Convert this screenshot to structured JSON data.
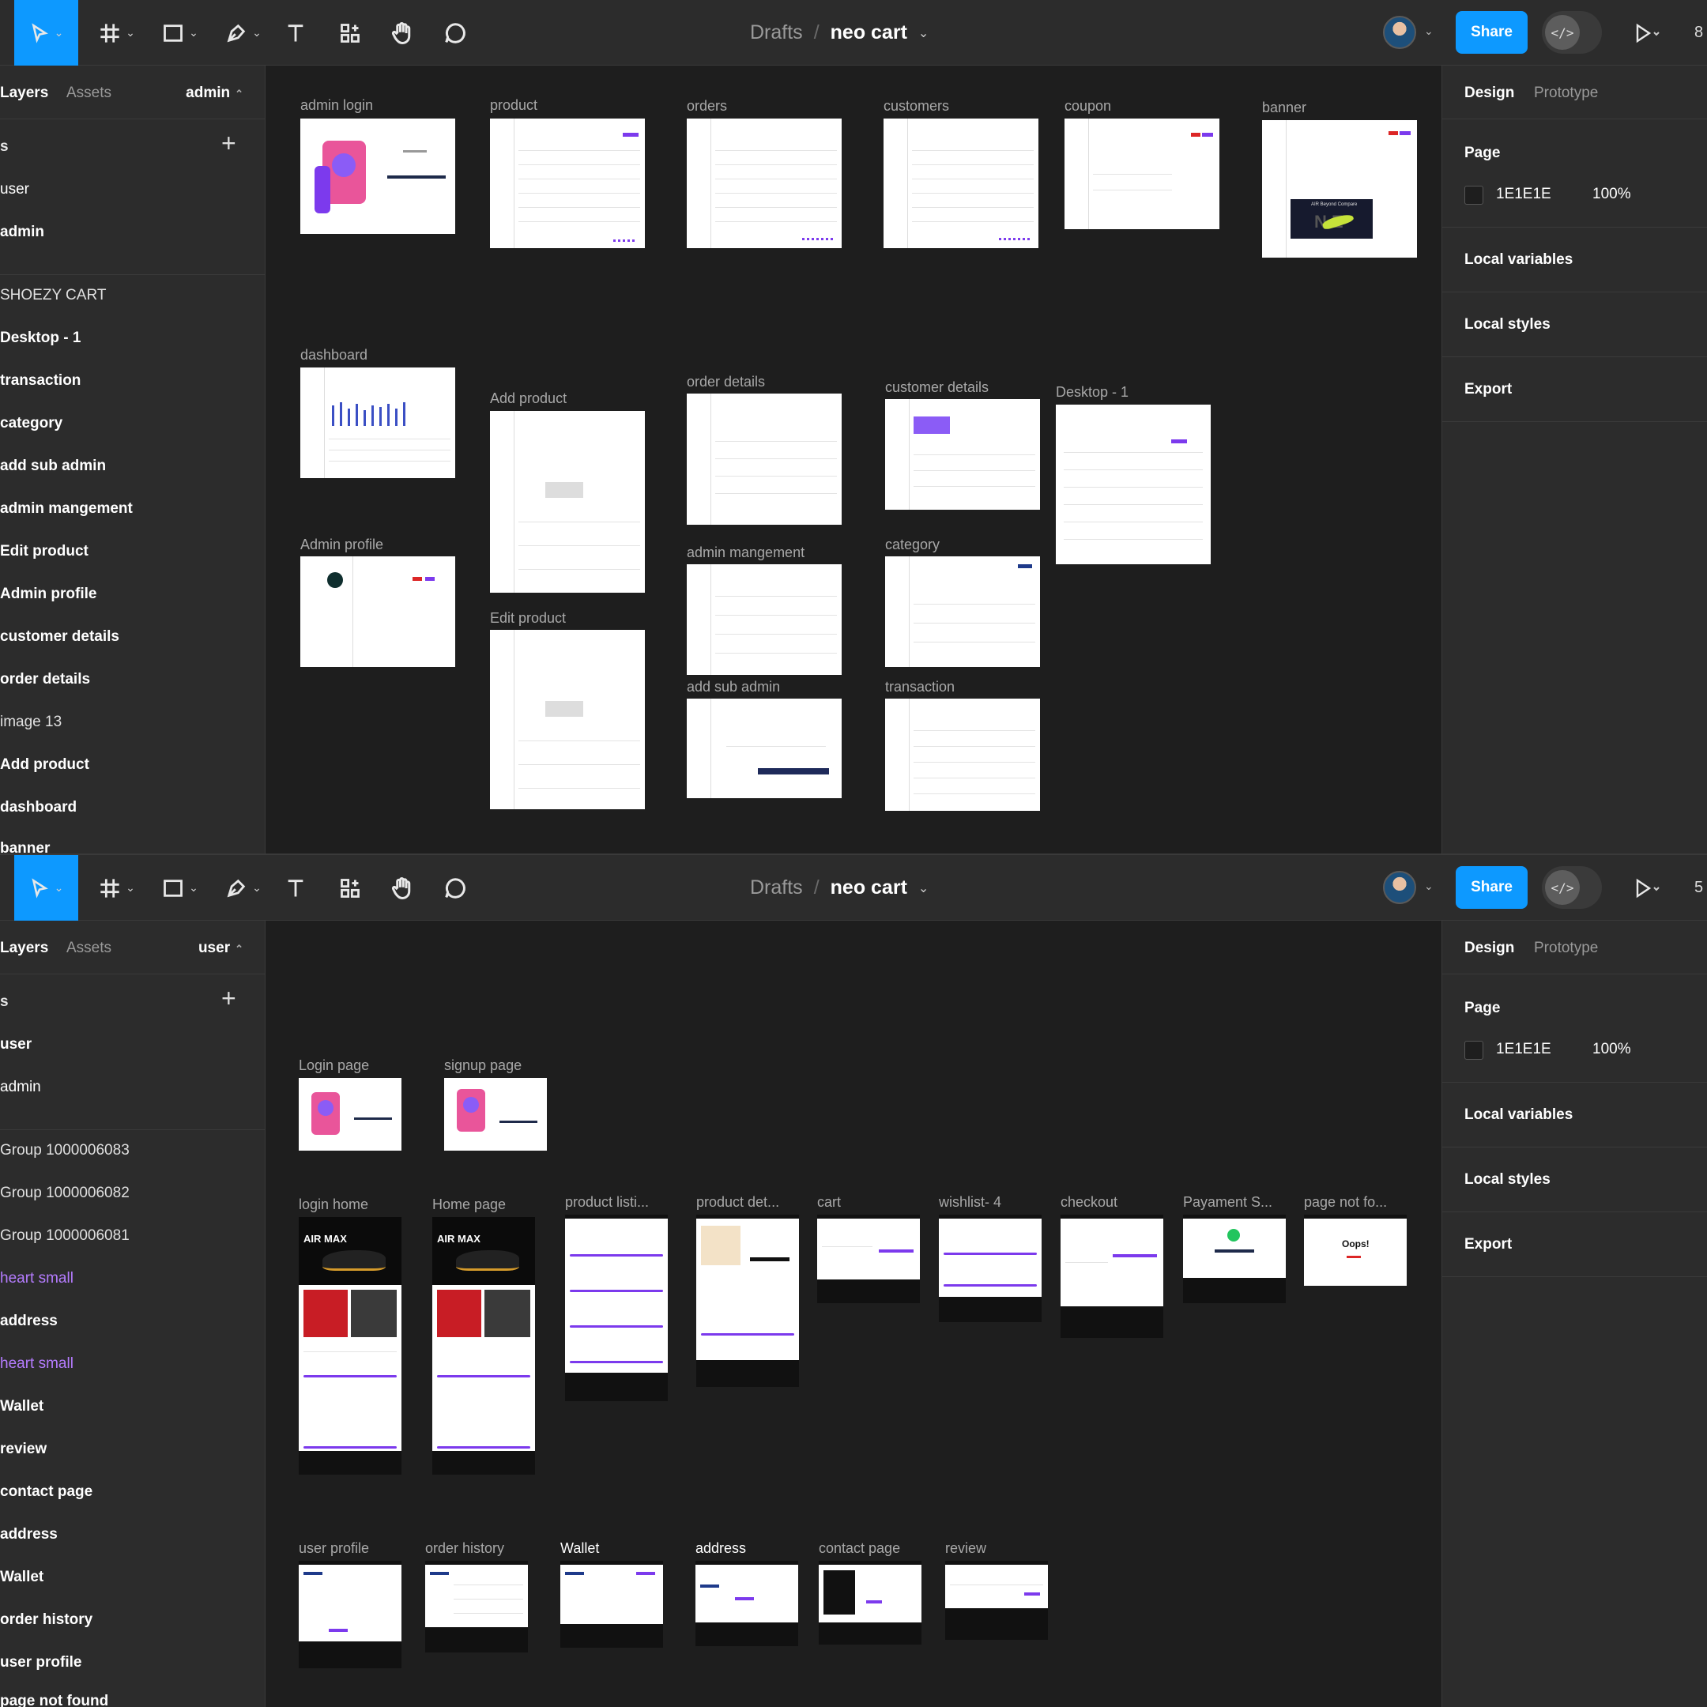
{
  "panes": [
    {
      "file": {
        "drafts": "Drafts",
        "sep": "/",
        "name": "neo cart"
      },
      "share_label": "Share",
      "zoom_partial": "8",
      "left": {
        "tab_layers": "Layers",
        "tab_assets": "Assets",
        "current_page": "admin",
        "pages_header": "s",
        "pages": [
          "user",
          "admin"
        ],
        "layers": [
          "SHOEZY CART",
          "Desktop - 1",
          "transaction",
          "category",
          "add sub admin",
          "admin mangement",
          "Edit product",
          "Admin profile",
          "customer details",
          "order details",
          "image 13",
          "Add product",
          "dashboard",
          "banner"
        ]
      },
      "right": {
        "tab_design": "Design",
        "tab_prototype": "Prototype",
        "page_label": "Page",
        "color_hex": "1E1E1E",
        "opacity": "100%",
        "local_variables": "Local variables",
        "local_styles": "Local styles",
        "export": "Export"
      },
      "frames": [
        "admin login",
        "product",
        "orders",
        "customers",
        "coupon",
        "banner",
        "dashboard",
        "Add product",
        "order details",
        "customer details",
        "Desktop - 1",
        "Admin profile",
        "admin mangement",
        "category",
        "Edit product",
        "add sub admin",
        "transaction"
      ],
      "frame_text": {
        "banner_promo": "AIR Beyond Compare",
        "banner_word": "N  E"
      }
    },
    {
      "file": {
        "drafts": "Drafts",
        "sep": "/",
        "name": "neo cart"
      },
      "share_label": "Share",
      "zoom_partial": "5",
      "left": {
        "tab_layers": "Layers",
        "tab_assets": "Assets",
        "current_page": "user",
        "pages_header": "s",
        "pages": [
          "user",
          "admin"
        ],
        "layers": [
          "Group 1000006083",
          "Group 1000006082",
          "Group 1000006081",
          "heart small",
          "address",
          "heart small",
          "Wallet",
          "review",
          "contact page",
          "address",
          "Wallet",
          "order history",
          "user profile",
          "page not found"
        ]
      },
      "right": {
        "tab_design": "Design",
        "tab_prototype": "Prototype",
        "page_label": "Page",
        "color_hex": "1E1E1E",
        "opacity": "100%",
        "local_variables": "Local variables",
        "local_styles": "Local styles",
        "export": "Export"
      },
      "frames": [
        "Login page",
        "signup page",
        "login home",
        "Home page",
        "product listi...",
        "product det...",
        "cart",
        "wishlist- 4",
        "checkout",
        "Payament S...",
        "page not fo...",
        "user profile",
        "order history",
        "Wallet",
        "address",
        "contact page",
        "review"
      ],
      "frame_text": {
        "air_max": "AIR MAX",
        "air_max_2": "AIR MAX",
        "oops": "Oops!"
      }
    }
  ],
  "colors": {
    "accent": "#0d99ff",
    "bg": "#1e1e1e",
    "panel": "#2c2c2c",
    "purple": "#7c3aed",
    "layer_purple": "#b57cff"
  }
}
